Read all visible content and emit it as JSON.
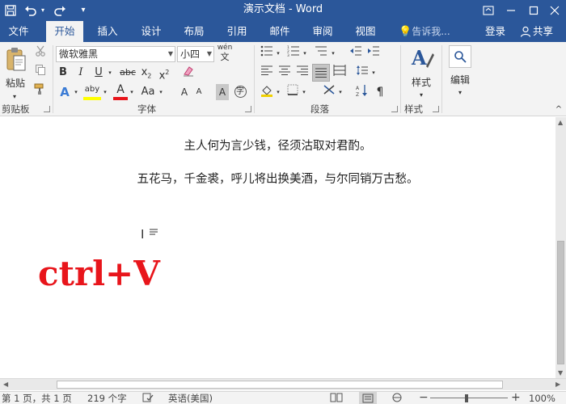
{
  "titlebar": {
    "title": "演示文档 - Word",
    "save_icon": "save-icon",
    "undo_icon": "undo-icon",
    "redo_icon": "redo-icon",
    "customize_icon": "customize-qat-icon",
    "ribbon_display_icon": "ribbon-display-options-icon",
    "minimize_icon": "minimize-icon",
    "maximize_icon": "maximize-icon",
    "close_icon": "close-icon",
    "colors": {
      "background": "#2b579a"
    }
  },
  "tabs": [
    {
      "label": "文件"
    },
    {
      "label": "开始"
    },
    {
      "label": "插入"
    },
    {
      "label": "设计"
    },
    {
      "label": "布局"
    },
    {
      "label": "引用"
    },
    {
      "label": "邮件"
    },
    {
      "label": "审阅"
    },
    {
      "label": "视图"
    }
  ],
  "tell_me": "告诉我...",
  "sign_in": "登录",
  "share": "共享",
  "ribbon": {
    "clipboard": {
      "paste_label": "粘贴",
      "group_label": "剪贴板"
    },
    "font": {
      "font_name": "微软雅黑",
      "font_size": "小四",
      "wen_label": "wén",
      "wen_char": "文",
      "bold": "B",
      "italic": "I",
      "underline": "U",
      "strike": "abc",
      "subscript": "x",
      "superscript": "x",
      "text_effects": "A",
      "highlight_label": "aby",
      "font_color": "A",
      "change_case": "Aa",
      "grow": "A",
      "shrink": "A",
      "char_shading": "A",
      "enclose_char": "字",
      "group_label": "字体"
    },
    "paragraph": {
      "group_label": "段落"
    },
    "styles": {
      "styles_label": "样式",
      "group_label": "样式"
    },
    "editing": {
      "editing_label": "编辑"
    }
  },
  "document": {
    "lines": [
      "主人何为言少钱，径须沽取对君酌。",
      "五花马，千金裘，呼儿将出换美酒，与尔同销万古愁。"
    ],
    "overlay_text": "ctrl+V",
    "overlay_color": "#e8151b"
  },
  "statusbar": {
    "page": "第 1 页，共 1 页",
    "words": "219 个字",
    "language": "英语(美国)",
    "zoom": "100%",
    "zoom_level_percent": 100
  }
}
